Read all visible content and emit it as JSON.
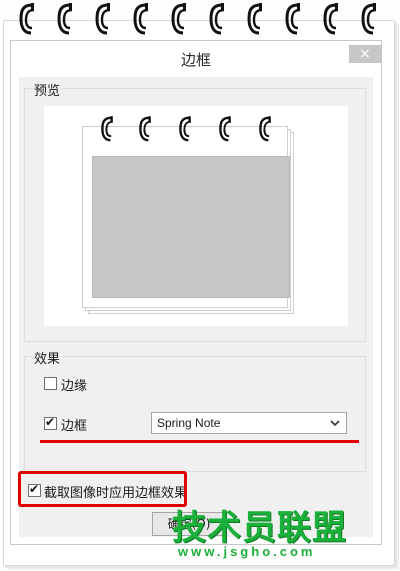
{
  "dialog": {
    "title": "边框",
    "close_glyph": "×"
  },
  "preview": {
    "group_label": "预览"
  },
  "effects": {
    "group_label": "效果",
    "edge": {
      "label": "边缘",
      "checked": false
    },
    "border": {
      "label": "边框",
      "checked": true
    },
    "border_style": {
      "selected": "Spring Note"
    }
  },
  "apply_on_capture": {
    "label": "截取图像时应用边框效果",
    "checked": true
  },
  "ok_button": {
    "label": "确定(O)"
  },
  "watermark": {
    "text": "技术员联盟",
    "url": "www.jsgho.com"
  },
  "colors": {
    "highlight": "#e00000",
    "watermark": "#1bb03a",
    "preview_photo": "#c6c6c6"
  },
  "icons": [
    "spring-ring-icon",
    "close-icon",
    "checkmark-icon",
    "chevron-down-icon"
  ]
}
